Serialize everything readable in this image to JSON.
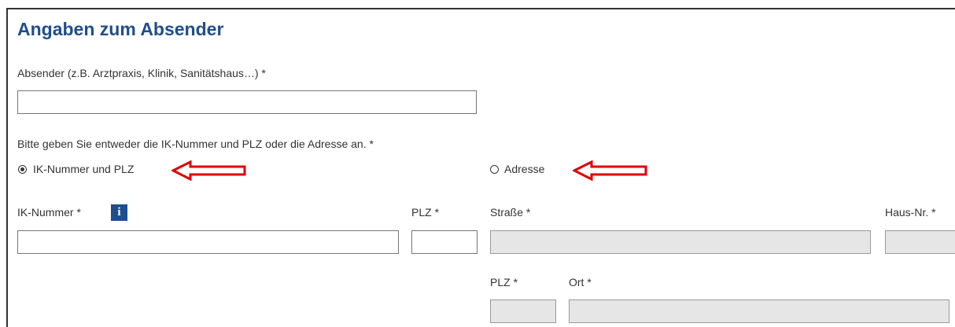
{
  "section": {
    "title": "Angaben zum Absender"
  },
  "sender": {
    "label": "Absender (z.B. Arztpraxis, Klinik, Sanitätshaus…) *",
    "value": ""
  },
  "choice": {
    "prompt": "Bitte geben Sie entweder die IK-Nummer und PLZ oder die Adresse an. *",
    "options": [
      {
        "label": "IK-Nummer und PLZ",
        "selected": true
      },
      {
        "label": "Adresse",
        "selected": false
      }
    ]
  },
  "ik": {
    "label": "IK-Nummer *",
    "info_glyph": "i",
    "info_icon": "info-icon",
    "value": ""
  },
  "plz": {
    "label": "PLZ *",
    "value": ""
  },
  "address": {
    "street_label": "Straße *",
    "house_label": "Haus-Nr. *",
    "plz_label": "PLZ *",
    "city_label": "Ort *",
    "disabled": true
  },
  "annotation": {
    "arrow_icon": "left-arrow-annotation",
    "arrow_color": "#e00000"
  },
  "colors": {
    "heading": "#1f4e8c",
    "disabled_field": "#e6e6e6",
    "annotation": "#e00000"
  }
}
